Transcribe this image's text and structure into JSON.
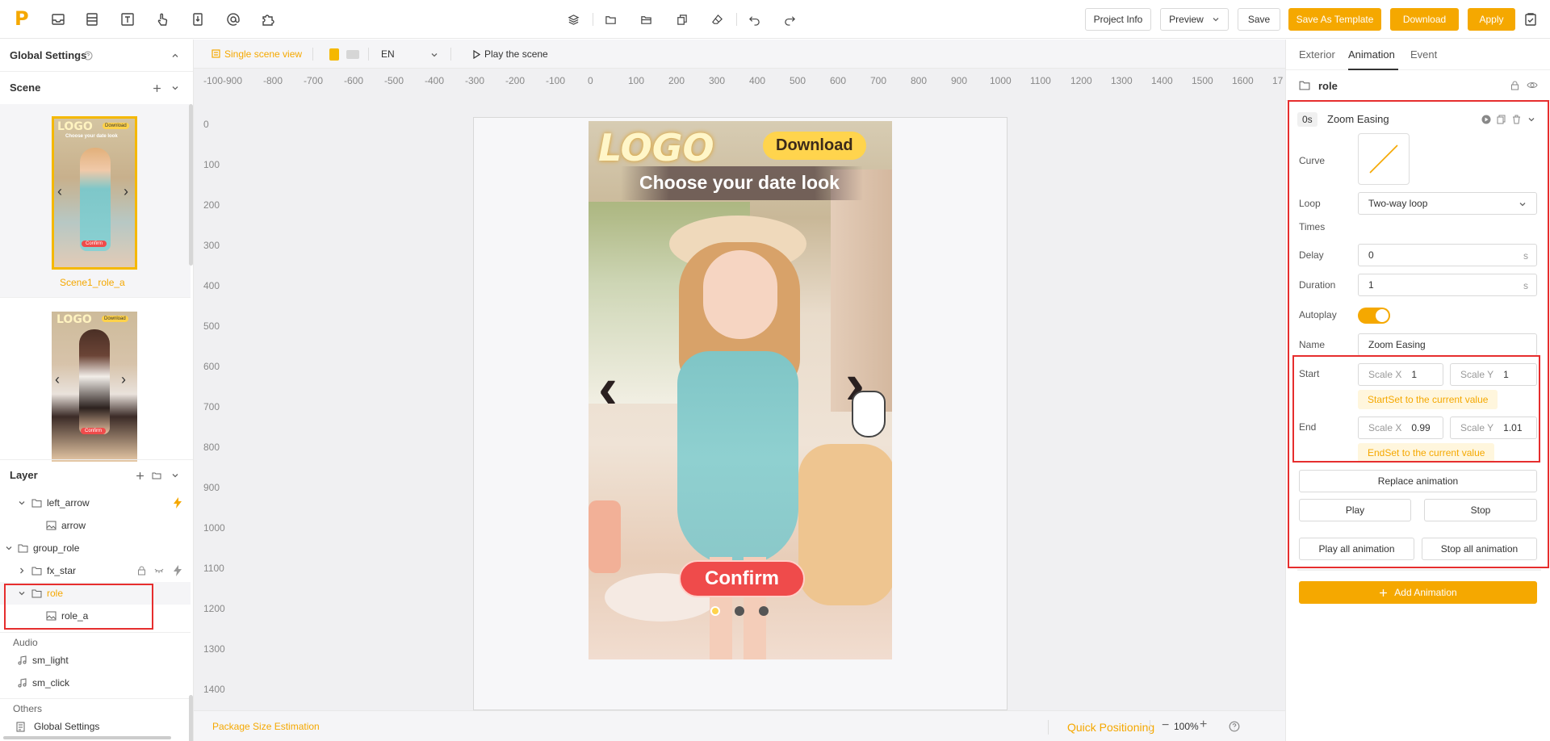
{
  "toolbar": {
    "logo": "P",
    "project_info": "Project Info",
    "preview": "Preview",
    "save": "Save",
    "save_template": "Save As Template",
    "download": "Download",
    "apply": "Apply"
  },
  "left": {
    "global_settings": "Global Settings",
    "scene_header": "Scene",
    "scene1_label": "Scene1_role_a",
    "layer_header": "Layer",
    "layers": [
      "left_arrow",
      "arrow",
      "group_role",
      "fx_star",
      "role",
      "role_a"
    ],
    "audio_header": "Audio",
    "audio": [
      "sm_light",
      "sm_click"
    ],
    "others_header": "Others",
    "others_item": "Global Settings"
  },
  "subbar": {
    "single_scene": "Single scene view",
    "lang": "EN",
    "play_scene": "Play the scene"
  },
  "ruler": {
    "x": [
      "-100",
      "-900",
      "-800",
      "-700",
      "-600",
      "-500",
      "-400",
      "-300",
      "-200",
      "-100",
      "0",
      "100",
      "200",
      "300",
      "400",
      "500",
      "600",
      "700",
      "800",
      "900",
      "1000",
      "1100",
      "1200",
      "1300",
      "1400",
      "1500",
      "1600",
      "17"
    ],
    "y": [
      "0",
      "100",
      "200",
      "300",
      "400",
      "500",
      "600",
      "700",
      "800",
      "900",
      "1000",
      "1100",
      "1200",
      "1300",
      "1400"
    ]
  },
  "ad": {
    "logo": "LOGO",
    "download": "Download",
    "tagline": "Choose your date look",
    "confirm": "Confirm",
    "thumb_logo": "LOGO",
    "thumb_download": "Download",
    "thumb_tagline": "Choose your date look",
    "thumb_confirm": "Confirm"
  },
  "bottom": {
    "package_size": "Package Size Estimation",
    "quick_positioning": "Quick Positioning",
    "zoom": "100%"
  },
  "right": {
    "tabs": [
      "Exterior",
      "Animation",
      "Event"
    ],
    "selected": "role",
    "anim_time": "0s",
    "anim_title": "Zoom Easing",
    "curve_label": "Curve",
    "loop_label": "Loop",
    "loop_value": "Two-way loop",
    "times_label": "Times",
    "delay_label": "Delay",
    "delay_value": "0",
    "unit_s": "s",
    "duration_label": "Duration",
    "duration_value": "1",
    "autoplay_label": "Autoplay",
    "autoplay_on": true,
    "name_label": "Name",
    "name_value": "Zoom Easing",
    "start_label": "Start",
    "scale_x": "Scale X",
    "scale_y": "Scale Y",
    "start_x": "1",
    "start_y": "1",
    "start_set": "StartSet to the current value",
    "end_label": "End",
    "end_x": "0.99",
    "end_y": "1.01",
    "end_set": "EndSet to the current value",
    "replace": "Replace animation",
    "play": "Play",
    "stop": "Stop",
    "play_all": "Play all animation",
    "stop_all": "Stop all animation",
    "add_anim": "Add Animation"
  },
  "colors": {
    "accent": "#f5a800",
    "highlight": "#e62e2e"
  }
}
